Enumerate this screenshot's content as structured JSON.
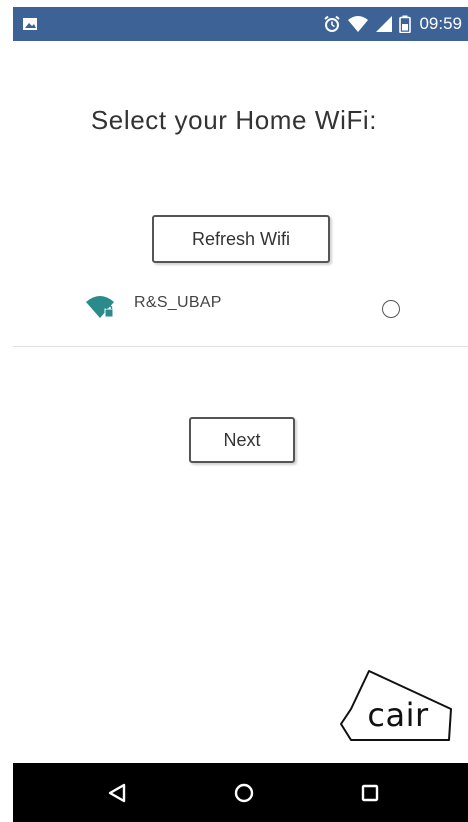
{
  "status_bar": {
    "time": "09:59",
    "icons": [
      "image-icon",
      "alarm-icon",
      "wifi-signal-icon",
      "cell-signal-icon",
      "battery-icon"
    ],
    "background_color": "#3d6396"
  },
  "page": {
    "title": "Select your Home WiFi:"
  },
  "buttons": {
    "refresh_label": "Refresh Wifi",
    "next_label": "Next"
  },
  "networks": [
    {
      "ssid": "R&S_UBAP",
      "icon": "wifi-lock-icon",
      "selected": false
    }
  ],
  "brand": {
    "logo_text": "cair"
  },
  "nav_bar": {
    "buttons": [
      "back-icon",
      "home-icon",
      "recents-icon"
    ]
  },
  "colors": {
    "wifi_icon": "#2a8a8c",
    "status_bar": "#3d6396",
    "nav_bar": "#000000"
  }
}
